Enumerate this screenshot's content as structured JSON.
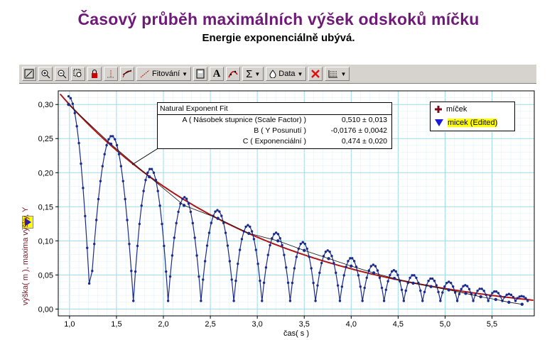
{
  "title": "Časový průběh maximálních výšek odskoků míčku",
  "subtitle": "Energie exponenciálně ubývá.",
  "toolbar": {
    "fit_label": "Fitování",
    "data_label": "Data",
    "sigma": "Σ",
    "text_tool": "A"
  },
  "fit_box": {
    "header": "Natural Exponent Fit",
    "rows": [
      {
        "label": "A ( Násobek stupnice (Scale Factor) )",
        "value": "0,510 ±   0,013"
      },
      {
        "label": "B ( Y Posunutí )",
        "value": "-0,0176 ± 0,0042"
      },
      {
        "label": "C ( Exponenciální )",
        "value": "0,474 ±   0,020"
      }
    ]
  },
  "legend": {
    "items": [
      "míček",
      "micek (Edited)"
    ]
  },
  "colors": {
    "title": "#6f1a78",
    "fit_curve": "#b01414",
    "data_series": "#1c2a8c",
    "grid": "#9fd9e8"
  },
  "chart_data": {
    "type": "line",
    "xlabel": "čas( s )",
    "ylabel": "výška( m ), maxima výšky, Y",
    "xlim": [
      0.88,
      5.95
    ],
    "ylim": [
      -0.01,
      0.32
    ],
    "x_ticks": [
      "1,0",
      "1,5",
      "2,0",
      "2,5",
      "3,0",
      "3,5",
      "4,0",
      "4,5",
      "5,0",
      "5,5"
    ],
    "y_ticks": [
      "0,00",
      "0,05",
      "0,10",
      "0,15",
      "0,20",
      "0,25",
      "0,30"
    ],
    "grid": true,
    "legend_position": "top-right",
    "series": [
      {
        "name": "míček",
        "bounces": [
          {
            "t_start": 0.92,
            "t_end": 1.22,
            "peak": 0.3
          },
          {
            "t_start": 1.22,
            "t_end": 1.68,
            "peak": 0.242
          },
          {
            "t_start": 1.68,
            "t_end": 2.05,
            "peak": 0.194
          },
          {
            "t_start": 2.05,
            "t_end": 2.4,
            "peak": 0.152
          },
          {
            "t_start": 2.4,
            "t_end": 2.75,
            "peak": 0.133
          },
          {
            "t_start": 2.75,
            "t_end": 3.05,
            "peak": 0.111
          },
          {
            "t_start": 3.05,
            "t_end": 3.35,
            "peak": 0.1
          },
          {
            "t_start": 3.35,
            "t_end": 3.62,
            "peak": 0.086
          },
          {
            "t_start": 3.62,
            "t_end": 3.88,
            "peak": 0.074
          },
          {
            "t_start": 3.88,
            "t_end": 4.12,
            "peak": 0.063
          },
          {
            "t_start": 4.12,
            "t_end": 4.35,
            "peak": 0.053
          },
          {
            "t_start": 4.35,
            "t_end": 4.56,
            "peak": 0.045
          },
          {
            "t_start": 4.56,
            "t_end": 4.76,
            "peak": 0.038
          },
          {
            "t_start": 4.76,
            "t_end": 4.95,
            "peak": 0.033
          },
          {
            "t_start": 4.95,
            "t_end": 5.13,
            "peak": 0.028
          },
          {
            "t_start": 5.13,
            "t_end": 5.3,
            "peak": 0.023
          },
          {
            "t_start": 5.3,
            "t_end": 5.46,
            "peak": 0.018
          },
          {
            "t_start": 5.46,
            "t_end": 5.61,
            "peak": 0.014
          },
          {
            "t_start": 5.61,
            "t_end": 5.75,
            "peak": 0.01
          },
          {
            "t_start": 5.75,
            "t_end": 5.88,
            "peak": 0.007
          }
        ]
      },
      {
        "name": "micek (Edited)",
        "x": [
          0.99,
          1.44,
          1.85,
          2.22,
          2.58,
          2.91,
          3.22,
          3.5,
          3.76,
          4.0,
          4.24,
          4.46,
          4.66,
          4.85,
          5.04,
          5.22,
          5.38,
          5.54,
          5.68,
          5.82
        ],
        "y": [
          0.3,
          0.242,
          0.194,
          0.152,
          0.133,
          0.111,
          0.1,
          0.086,
          0.074,
          0.063,
          0.053,
          0.045,
          0.038,
          0.033,
          0.028,
          0.023,
          0.018,
          0.014,
          0.01,
          0.007
        ]
      }
    ],
    "fit": {
      "model": "A*exp(-C*t)+B",
      "A": 0.51,
      "B": -0.0176,
      "C": 0.474
    }
  }
}
